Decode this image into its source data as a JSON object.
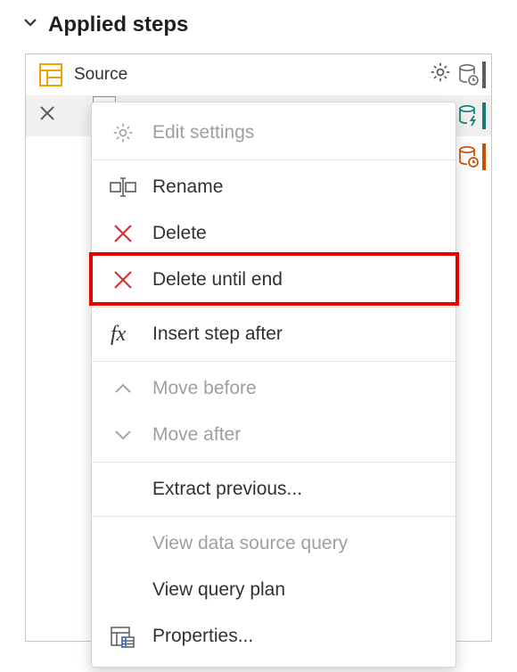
{
  "header": {
    "title": "Applied steps"
  },
  "steps": {
    "source_label": "Source"
  },
  "menu": {
    "edit_settings": "Edit settings",
    "rename": "Rename",
    "delete": "Delete",
    "delete_until_end": "Delete until end",
    "insert_step_after": "Insert step after",
    "move_before": "Move before",
    "move_after": "Move after",
    "extract_previous": "Extract previous...",
    "view_data_source_query": "View data source query",
    "view_query_plan": "View query plan",
    "properties": "Properties..."
  },
  "colors": {
    "orange": "#f2a100",
    "teal": "#0f7e7a",
    "dark_orange": "#c65000",
    "gray_icon": "#5c5c5c",
    "red": "#d13438"
  }
}
